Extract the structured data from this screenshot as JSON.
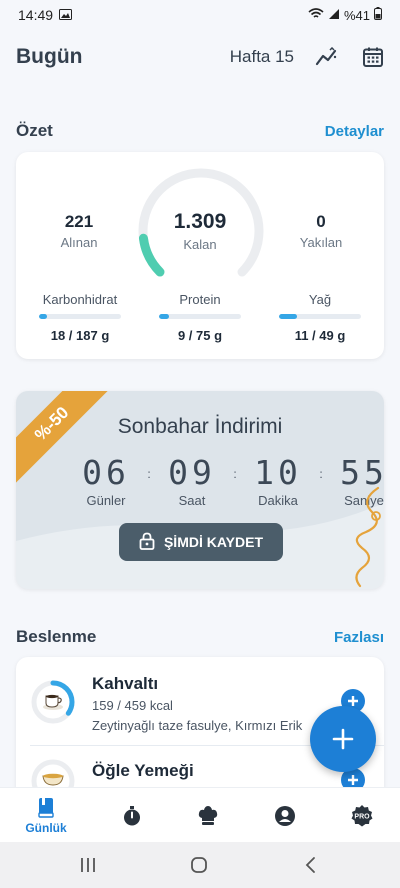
{
  "status_bar": {
    "time": "14:49",
    "battery": "%41"
  },
  "header": {
    "title": "Bugün",
    "week": "Hafta 15"
  },
  "summary": {
    "title": "Özet",
    "link": "Detaylar",
    "eaten_value": "221",
    "eaten_label": "Alınan",
    "remaining_value": "1.309",
    "remaining_label": "Kalan",
    "burned_value": "0",
    "burned_label": "Yakılan",
    "ring_progress": 0.14,
    "macros": [
      {
        "name": "Karbonhidrat",
        "value": "18 / 187 g",
        "progress": 0.1
      },
      {
        "name": "Protein",
        "value": "9 / 75 g",
        "progress": 0.12
      },
      {
        "name": "Yağ",
        "value": "11 / 49 g",
        "progress": 0.22
      }
    ]
  },
  "promo": {
    "badge": "%-50",
    "title": "Sonbahar İndirimi",
    "countdown": [
      {
        "value": "06",
        "label": "Günler"
      },
      {
        "value": "09",
        "label": "Saat"
      },
      {
        "value": "10",
        "label": "Dakika"
      },
      {
        "value": "55",
        "label": "Saniye"
      }
    ],
    "separator": ":",
    "button": "ŞİMDİ KAYDET"
  },
  "nutrition": {
    "title": "Beslenme",
    "link": "Fazlası",
    "meals": [
      {
        "name": "Kahvaltı",
        "kcal": "159 / 459 kcal",
        "desc": "Zeytinyağlı taze fasulye, Kırmızı Erik",
        "progress": 0.35
      },
      {
        "name": "Öğle Yemeği",
        "kcal": "",
        "desc": "",
        "progress": 0
      }
    ]
  },
  "bottom_nav": {
    "active_label": "Günlük"
  },
  "colors": {
    "accent": "#1d7fd6",
    "ring": "#4fcdb0",
    "promo_badge": "#e5a33b"
  }
}
